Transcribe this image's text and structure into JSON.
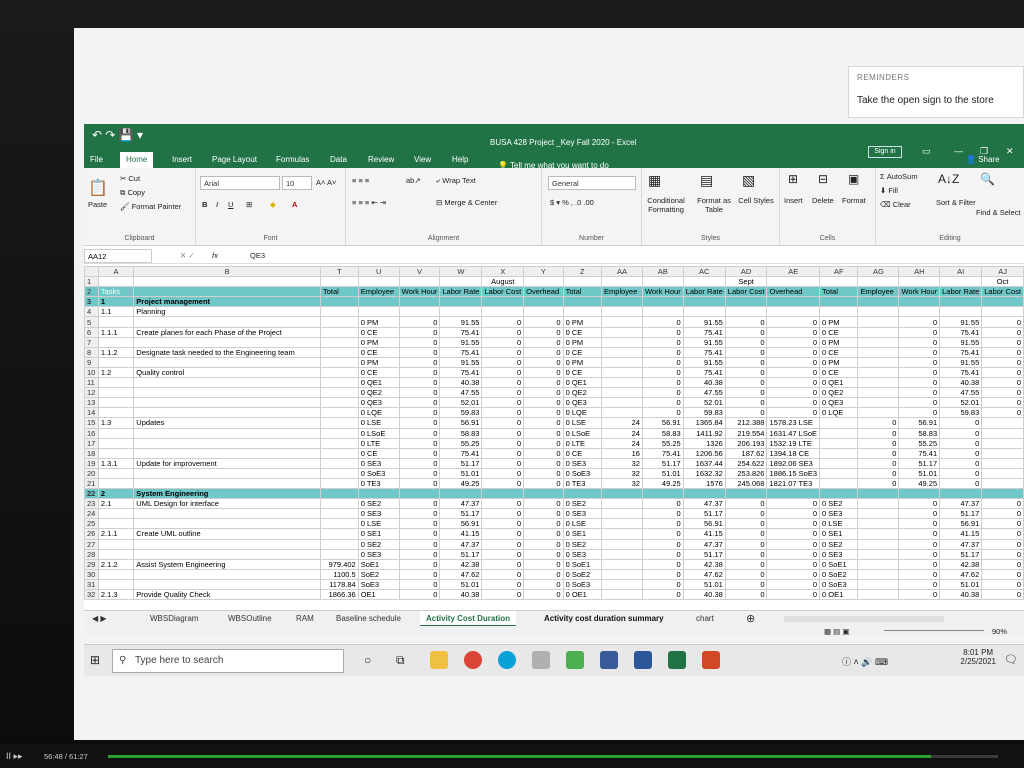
{
  "reminder": {
    "header": "REMINDERS",
    "text": "Take the open sign to the store"
  },
  "window": {
    "title": "BUSA 428 Project _Key Fall 2020  -  Excel",
    "signin": "Sign in",
    "share": "Share"
  },
  "tabs": [
    "File",
    "Home",
    "Insert",
    "Page Layout",
    "Formulas",
    "Data",
    "Review",
    "View",
    "Help"
  ],
  "tell_me": "Tell me what you want to do",
  "ribbon": {
    "clipboard": {
      "paste": "Paste",
      "cut": "Cut",
      "copy": "Copy",
      "format_painter": "Format Painter",
      "label": "Clipboard"
    },
    "font": {
      "name": "Arial",
      "size": "10",
      "label": "Font"
    },
    "alignment": {
      "wrap": "Wrap Text",
      "merge": "Merge & Center",
      "label": "Alignment"
    },
    "number": {
      "format": "General",
      "label": "Number"
    },
    "styles": {
      "cond": "Conditional Formatting",
      "table": "Format as Table",
      "cell": "Cell Styles",
      "label": "Styles"
    },
    "cells": {
      "insert": "Insert",
      "delete": "Delete",
      "format": "Format",
      "label": "Cells"
    },
    "editing": {
      "autosum": "AutoSum",
      "fill": "Fill",
      "clear": "Clear",
      "sort": "Sort & Filter",
      "find": "Find & Select",
      "label": "Editing"
    }
  },
  "formula_bar": {
    "name_box": "AA12",
    "fx": "fx",
    "value": "QE3"
  },
  "columns": [
    "A",
    "B",
    "T",
    "U",
    "V",
    "W",
    "X",
    "Y",
    "Z",
    "AA",
    "AB",
    "AC",
    "AD",
    "AE",
    "AF",
    "AG",
    "AH",
    "AI",
    "AJ"
  ],
  "header_row1": [
    "",
    "",
    "",
    "",
    "",
    "",
    "August",
    "",
    "",
    "",
    "",
    "",
    "Sept",
    "",
    "",
    "",
    "",
    "",
    "Oct"
  ],
  "header_row2": [
    "Tasks",
    "",
    "Total",
    "Employee",
    "Work Hour",
    "Labor Rate",
    "Labor Cost",
    "Overhead",
    "Total",
    "Employee",
    "Work Hour",
    "Labor Rate",
    "Labor Cost",
    "Overhead",
    "Total",
    "Employee",
    "Work Hour",
    "Labor Rate",
    "Labor Cost"
  ],
  "rows": [
    {
      "n": "3",
      "cls": "sec",
      "c": [
        "1",
        "Project management",
        "",
        "",
        "",
        "",
        "",
        "",
        "",
        "",
        "",
        "",
        "",
        "",
        "",
        "",
        "",
        "",
        ""
      ]
    },
    {
      "n": "4",
      "c": [
        "1.1",
        "Planning",
        "",
        "",
        "",
        "",
        "",
        "",
        "",
        "",
        "",
        "",
        "",
        "",
        "",
        "",
        "",
        "",
        ""
      ]
    },
    {
      "n": "5",
      "c": [
        "",
        "",
        "",
        "0 PM",
        "0",
        "91.55",
        "0",
        "0",
        "0 PM",
        "",
        "0",
        "91.55",
        "0",
        "0",
        "0 PM",
        "",
        "0",
        "91.55",
        "0"
      ]
    },
    {
      "n": "6",
      "c": [
        "1.1.1",
        "Create planes for each Phase of the Project",
        "",
        "0 CE",
        "0",
        "75.41",
        "0",
        "0",
        "0 CE",
        "",
        "0",
        "75.41",
        "0",
        "0",
        "0 CE",
        "",
        "0",
        "75.41",
        "0"
      ]
    },
    {
      "n": "7",
      "c": [
        "",
        "",
        "",
        "0 PM",
        "0",
        "91.55",
        "0",
        "0",
        "0 PM",
        "",
        "0",
        "91.55",
        "0",
        "0",
        "0 PM",
        "",
        "0",
        "91.55",
        "0"
      ]
    },
    {
      "n": "8",
      "c": [
        "1.1.2",
        "Designate task needed to the Engineering team",
        "",
        "0 CE",
        "0",
        "75.41",
        "0",
        "0",
        "0 CE",
        "",
        "0",
        "75.41",
        "0",
        "0",
        "0 CE",
        "",
        "0",
        "75.41",
        "0"
      ]
    },
    {
      "n": "9",
      "c": [
        "",
        "",
        "",
        "0 PM",
        "0",
        "91.55",
        "0",
        "0",
        "0 PM",
        "",
        "0",
        "91.55",
        "0",
        "0",
        "0 PM",
        "",
        "0",
        "91.55",
        "0"
      ]
    },
    {
      "n": "10",
      "c": [
        "1.2",
        "Quality control",
        "",
        "0 CE",
        "0",
        "75.41",
        "0",
        "0",
        "0 CE",
        "",
        "0",
        "75.41",
        "0",
        "0",
        "0 CE",
        "",
        "0",
        "75.41",
        "0"
      ]
    },
    {
      "n": "11",
      "c": [
        "",
        "",
        "",
        "0 QE1",
        "0",
        "40.38",
        "0",
        "0",
        "0 QE1",
        "",
        "0",
        "40.38",
        "0",
        "0",
        "0 QE1",
        "",
        "0",
        "40.38",
        "0"
      ]
    },
    {
      "n": "12",
      "c": [
        "",
        "",
        "",
        "0 QE2",
        "0",
        "47.55",
        "0",
        "0",
        "0 QE2",
        "",
        "0",
        "47.55",
        "0",
        "0",
        "0 QE2",
        "",
        "0",
        "47.55",
        "0"
      ]
    },
    {
      "n": "13",
      "c": [
        "",
        "",
        "",
        "0 QE3",
        "0",
        "52.01",
        "0",
        "0",
        "0 QE3",
        "",
        "0",
        "52.01",
        "0",
        "0",
        "0 QE3",
        "",
        "0",
        "52.01",
        "0"
      ]
    },
    {
      "n": "14",
      "c": [
        "",
        "",
        "",
        "0 LQE",
        "0",
        "59.83",
        "0",
        "0",
        "0 LQE",
        "",
        "0",
        "59.83",
        "0",
        "0",
        "0 LQE",
        "",
        "0",
        "59.83",
        "0"
      ]
    },
    {
      "n": "15",
      "c": [
        "1.3",
        "Updates",
        "",
        "0 LSE",
        "0",
        "56.91",
        "0",
        "0",
        "0 LSE",
        "24",
        "56.91",
        "1365.84",
        "212.388",
        "1578.23 LSE",
        "",
        "0",
        "56.91",
        "0",
        ""
      ]
    },
    {
      "n": "16",
      "c": [
        "",
        "",
        "",
        "0 LSoE",
        "0",
        "58.83",
        "0",
        "0",
        "0 LSoE",
        "24",
        "58.83",
        "1411.92",
        "219.554",
        "1631.47 LSoE",
        "",
        "0",
        "58.83",
        "0",
        ""
      ]
    },
    {
      "n": "17",
      "c": [
        "",
        "",
        "",
        "0 LTE",
        "0",
        "55.25",
        "0",
        "0",
        "0 LTE",
        "24",
        "55.25",
        "1326",
        "206.193",
        "1532.19 LTE",
        "",
        "0",
        "55.25",
        "0",
        ""
      ]
    },
    {
      "n": "18",
      "c": [
        "",
        "",
        "",
        "0 CE",
        "0",
        "75.41",
        "0",
        "0",
        "0 CE",
        "16",
        "75.41",
        "1206.56",
        "187.62",
        "1394.18 CE",
        "",
        "0",
        "75.41",
        "0",
        ""
      ]
    },
    {
      "n": "19",
      "c": [
        "1.3.1",
        "Update for improvement",
        "",
        "0 SE3",
        "0",
        "51.17",
        "0",
        "0",
        "0 SE3",
        "32",
        "51.17",
        "1637.44",
        "254.622",
        "1892.06 SE3",
        "",
        "0",
        "51.17",
        "0",
        ""
      ]
    },
    {
      "n": "20",
      "c": [
        "",
        "",
        "",
        "0 SoE3",
        "0",
        "51.01",
        "0",
        "0",
        "0 SoE3",
        "32",
        "51.01",
        "1632.32",
        "253.826",
        "1886.15 SoE3",
        "",
        "0",
        "51.01",
        "0",
        ""
      ]
    },
    {
      "n": "21",
      "c": [
        "",
        "",
        "",
        "0 TE3",
        "0",
        "49.25",
        "0",
        "0",
        "0 TE3",
        "32",
        "49.25",
        "1576",
        "245.068",
        "1821.07 TE3",
        "",
        "0",
        "49.25",
        "0",
        ""
      ]
    },
    {
      "n": "22",
      "cls": "sec",
      "c": [
        "2",
        "System Engineering",
        "",
        "",
        "",
        "",
        "",
        "",
        "",
        "",
        "",
        "",
        "",
        "",
        "",
        "",
        "",
        "",
        ""
      ]
    },
    {
      "n": "23",
      "c": [
        "2.1",
        "UML Design for interface",
        "",
        "0 SE2",
        "0",
        "47.37",
        "0",
        "0",
        "0 SE2",
        "",
        "0",
        "47.37",
        "0",
        "0",
        "0 SE2",
        "",
        "0",
        "47.37",
        "0"
      ]
    },
    {
      "n": "24",
      "c": [
        "",
        "",
        "",
        "0 SE3",
        "0",
        "51.17",
        "0",
        "0",
        "0 SE3",
        "",
        "0",
        "51.17",
        "0",
        "0",
        "0 SE3",
        "",
        "0",
        "51.17",
        "0"
      ]
    },
    {
      "n": "25",
      "c": [
        "",
        "",
        "",
        "0 LSE",
        "0",
        "56.91",
        "0",
        "0",
        "0 LSE",
        "",
        "0",
        "56.91",
        "0",
        "0",
        "0 LSE",
        "",
        "0",
        "56.91",
        "0"
      ]
    },
    {
      "n": "26",
      "c": [
        "2.1.1",
        "Create UML outline",
        "",
        "0 SE1",
        "0",
        "41.15",
        "0",
        "0",
        "0 SE1",
        "",
        "0",
        "41.15",
        "0",
        "0",
        "0 SE1",
        "",
        "0",
        "41.15",
        "0"
      ]
    },
    {
      "n": "27",
      "c": [
        "",
        "",
        "",
        "0 SE2",
        "0",
        "47.37",
        "0",
        "0",
        "0 SE2",
        "",
        "0",
        "47.37",
        "0",
        "0",
        "0 SE2",
        "",
        "0",
        "47.37",
        "0"
      ]
    },
    {
      "n": "28",
      "c": [
        "",
        "",
        "",
        "0 SE3",
        "0",
        "51.17",
        "0",
        "0",
        "0 SE3",
        "",
        "0",
        "51.17",
        "0",
        "0",
        "0 SE3",
        "",
        "0",
        "51.17",
        "0"
      ]
    },
    {
      "n": "29",
      "c": [
        "2.1.2",
        "Assist System Engineering",
        "979.402",
        "SoE1",
        "0",
        "42.38",
        "0",
        "0",
        "0 SoE1",
        "",
        "0",
        "42.38",
        "0",
        "0",
        "0 SoE1",
        "",
        "0",
        "42.38",
        "0"
      ]
    },
    {
      "n": "30",
      "c": [
        "",
        "",
        "1100.5",
        "SoE2",
        "0",
        "47.62",
        "0",
        "0",
        "0 SoE2",
        "",
        "0",
        "47.62",
        "0",
        "0",
        "0 SoE2",
        "",
        "0",
        "47.62",
        "0"
      ]
    },
    {
      "n": "31",
      "c": [
        "",
        "",
        "1178.84",
        "SoE3",
        "0",
        "51.01",
        "0",
        "0",
        "0 SoE3",
        "",
        "0",
        "51.01",
        "0",
        "0",
        "0 SoE3",
        "",
        "0",
        "51.01",
        "0"
      ]
    },
    {
      "n": "32",
      "c": [
        "2.1.3",
        "Provide Quality Check",
        "1866.36",
        "OE1",
        "0",
        "40.38",
        "0",
        "0",
        "0 OE1",
        "",
        "0",
        "40.38",
        "0",
        "0",
        "0 OE1",
        "",
        "0",
        "40.38",
        "0"
      ]
    }
  ],
  "sheet_tabs": [
    "WBSDiagram",
    "WBSOutline",
    "RAM",
    "Baseline schedule",
    "Activity Cost Duration",
    "Activity cost duration summary",
    "chart"
  ],
  "active_sheet": "Activity Cost Duration",
  "zoom": "90%",
  "taskbar": {
    "search_placeholder": "Type here to search",
    "time": "8:01 PM",
    "date": "2/25/2021"
  },
  "video": {
    "time": "56:48 / 61:27",
    "progress": 0.925
  },
  "colors": {
    "excel_green": "#217346",
    "section_fill": "#6fc7c7"
  }
}
